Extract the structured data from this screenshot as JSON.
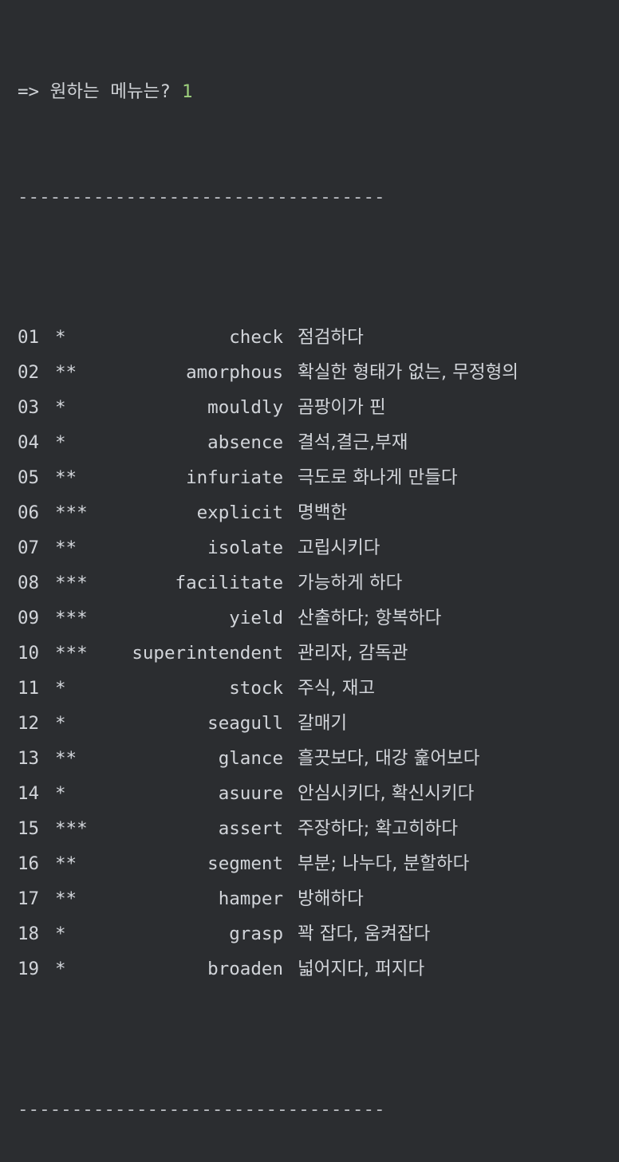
{
  "prompt": {
    "label": "=> 원하는 메뉴는?",
    "value": "1"
  },
  "divider": "----------------------------------",
  "words": [
    {
      "num": "01",
      "stars": "*",
      "word": "check",
      "meaning": "점검하다"
    },
    {
      "num": "02",
      "stars": "**",
      "word": "amorphous",
      "meaning": "확실한 형태가 없는, 무정형의"
    },
    {
      "num": "03",
      "stars": "*",
      "word": "mouldly",
      "meaning": "곰팡이가 핀"
    },
    {
      "num": "04",
      "stars": "*",
      "word": "absence",
      "meaning": "결석,결근,부재"
    },
    {
      "num": "05",
      "stars": "**",
      "word": "infuriate",
      "meaning": "극도로 화나게 만들다"
    },
    {
      "num": "06",
      "stars": "***",
      "word": "explicit",
      "meaning": "명백한"
    },
    {
      "num": "07",
      "stars": "**",
      "word": "isolate",
      "meaning": "고립시키다"
    },
    {
      "num": "08",
      "stars": "***",
      "word": "facilitate",
      "meaning": "가능하게 하다"
    },
    {
      "num": "09",
      "stars": "***",
      "word": "yield",
      "meaning": "산출하다; 항복하다"
    },
    {
      "num": "10",
      "stars": "***",
      "word": "superintendent",
      "meaning": "관리자, 감독관"
    },
    {
      "num": "11",
      "stars": "*",
      "word": "stock",
      "meaning": "주식, 재고"
    },
    {
      "num": "12",
      "stars": "*",
      "word": "seagull",
      "meaning": "갈매기"
    },
    {
      "num": "13",
      "stars": "**",
      "word": "glance",
      "meaning": "흘끗보다, 대강 훑어보다"
    },
    {
      "num": "14",
      "stars": "*",
      "word": "asuure",
      "meaning": "안심시키다, 확신시키다"
    },
    {
      "num": "15",
      "stars": "***",
      "word": "assert",
      "meaning": "주장하다; 확고히하다"
    },
    {
      "num": "16",
      "stars": "**",
      "word": "segment",
      "meaning": "부분; 나누다, 분할하다"
    },
    {
      "num": "17",
      "stars": "**",
      "word": "hamper",
      "meaning": "방해하다"
    },
    {
      "num": "18",
      "stars": "*",
      "word": "grasp",
      "meaning": "꽉 잡다, 움켜잡다"
    },
    {
      "num": "19",
      "stars": "*",
      "word": "broaden",
      "meaning": "넓어지다, 퍼지다"
    }
  ],
  "colors": {
    "background": "#2b2d30",
    "text": "#d2d5da",
    "input_value": "#9dcf7c"
  }
}
